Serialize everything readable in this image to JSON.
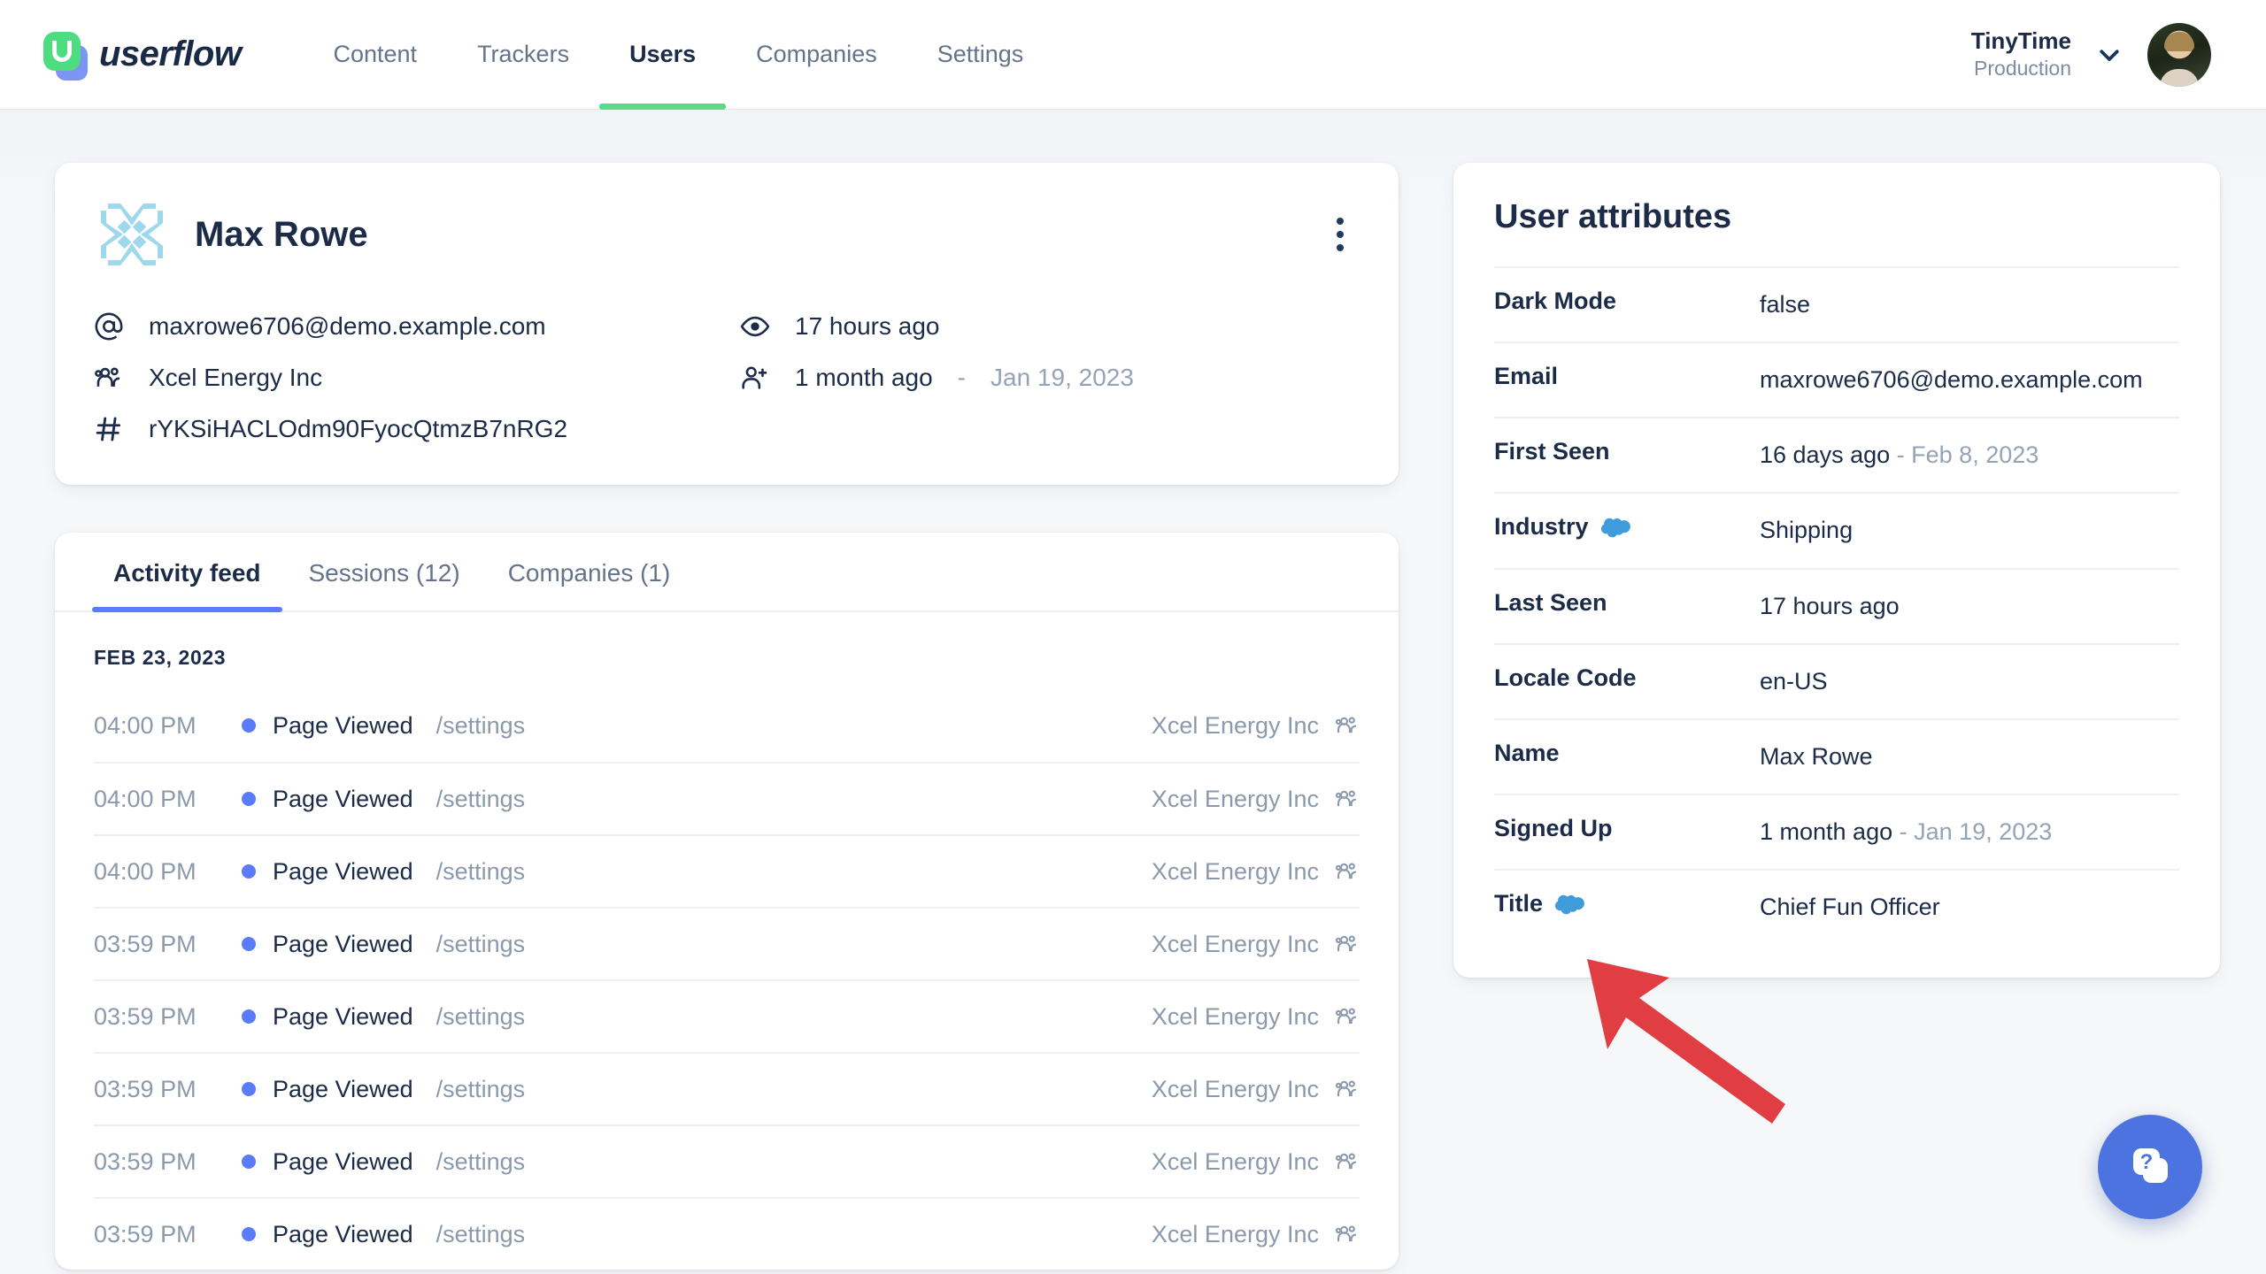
{
  "header": {
    "logo_text": "userflow",
    "logo_icon": "userflow-logo-icon",
    "nav": [
      {
        "label": "Content",
        "active": false
      },
      {
        "label": "Trackers",
        "active": false
      },
      {
        "label": "Users",
        "active": true
      },
      {
        "label": "Companies",
        "active": false
      },
      {
        "label": "Settings",
        "active": false
      }
    ],
    "org": {
      "name": "TinyTime",
      "environment": "Production"
    },
    "chevron_icon": "chevron-down-icon",
    "avatar": "user-avatar"
  },
  "profile": {
    "avatar_icon": "identicon-avatar",
    "name": "Max Rowe",
    "menu_icon": "kebab-menu-icon",
    "meta": [
      {
        "icon": "at-icon",
        "label": "maxrowe6706@demo.example.com"
      },
      {
        "icon": "eye-icon",
        "label": "17 hours ago"
      },
      {
        "icon": "users-group-icon",
        "label": "Xcel Energy Inc"
      },
      {
        "icon": "user-plus-icon",
        "label": "1 month ago",
        "dash": "-",
        "sub": "Jan 19, 2023"
      },
      {
        "icon": "hash-icon",
        "label": "rYKSiHACLOdm90FyocQtmzB7nRG2"
      }
    ]
  },
  "activity": {
    "tabs": [
      {
        "label": "Activity feed",
        "active": true
      },
      {
        "label": "Sessions (12)",
        "active": false
      },
      {
        "label": "Companies (1)",
        "active": false
      }
    ],
    "day_header": "FEB 23, 2023",
    "company_icon": "users-group-icon",
    "rows": [
      {
        "time": "04:00 PM",
        "event": "Page Viewed",
        "path": "/settings",
        "company": "Xcel Energy Inc"
      },
      {
        "time": "04:00 PM",
        "event": "Page Viewed",
        "path": "/settings",
        "company": "Xcel Energy Inc"
      },
      {
        "time": "04:00 PM",
        "event": "Page Viewed",
        "path": "/settings",
        "company": "Xcel Energy Inc"
      },
      {
        "time": "03:59 PM",
        "event": "Page Viewed",
        "path": "/settings",
        "company": "Xcel Energy Inc"
      },
      {
        "time": "03:59 PM",
        "event": "Page Viewed",
        "path": "/settings",
        "company": "Xcel Energy Inc"
      },
      {
        "time": "03:59 PM",
        "event": "Page Viewed",
        "path": "/settings",
        "company": "Xcel Energy Inc"
      },
      {
        "time": "03:59 PM",
        "event": "Page Viewed",
        "path": "/settings",
        "company": "Xcel Energy Inc"
      },
      {
        "time": "03:59 PM",
        "event": "Page Viewed",
        "path": "/settings",
        "company": "Xcel Energy Inc"
      }
    ]
  },
  "attributes": {
    "title": "User attributes",
    "source_icon": "salesforce-cloud-icon",
    "rows": [
      {
        "key": "Dark Mode",
        "badge": false,
        "value": "false",
        "muted": ""
      },
      {
        "key": "Email",
        "badge": false,
        "value": "maxrowe6706@demo.example.com",
        "muted": ""
      },
      {
        "key": "First Seen",
        "badge": false,
        "value": "16 days ago",
        "dash": "-",
        "muted": "Feb 8, 2023"
      },
      {
        "key": "Industry",
        "badge": true,
        "value": "Shipping",
        "muted": ""
      },
      {
        "key": "Last Seen",
        "badge": false,
        "value": "17 hours ago",
        "muted": ""
      },
      {
        "key": "Locale Code",
        "badge": false,
        "value": "en-US",
        "muted": ""
      },
      {
        "key": "Name",
        "badge": false,
        "value": "Max Rowe",
        "muted": ""
      },
      {
        "key": "Signed Up",
        "badge": false,
        "value": "1 month ago",
        "dash": "-",
        "muted": "Jan 19, 2023"
      },
      {
        "key": "Title",
        "badge": true,
        "value": "Chief Fun Officer",
        "muted": ""
      }
    ]
  },
  "annotation": {
    "arrow_icon": "red-pointer-arrow",
    "arrow_color": "#e03e42"
  },
  "help": {
    "icon": "resource-center-help-icon",
    "color": "#4d73e0"
  },
  "colors": {
    "brand_green": "#5ad98a",
    "accent_blue": "#5b7cfa",
    "salesforce_blue": "#3f9bd9",
    "text_dark": "#1b2b48",
    "text_muted": "#8b99ac",
    "page_bg": "#f4f6f8"
  }
}
